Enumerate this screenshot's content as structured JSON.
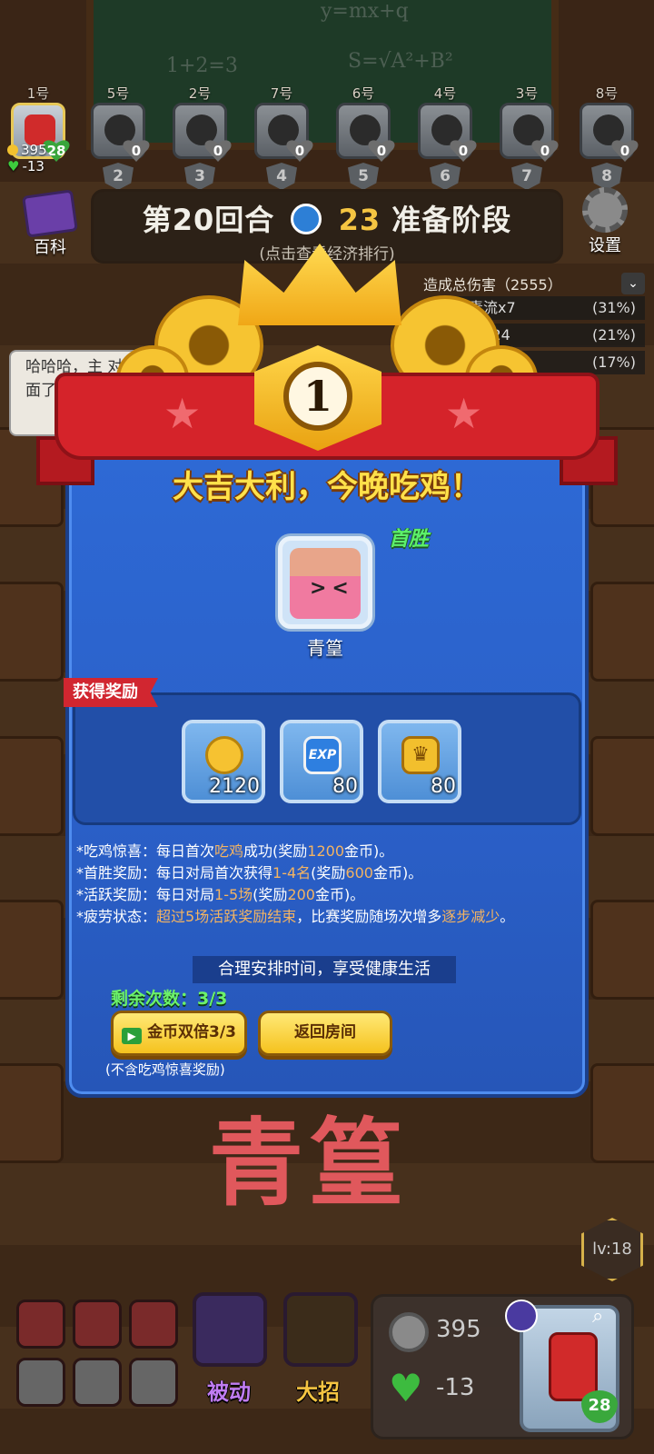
{
  "players": [
    {
      "no": "1号",
      "hp": "28",
      "rank": "",
      "me": true
    },
    {
      "no": "5号",
      "hp": "0",
      "rank": "2"
    },
    {
      "no": "2号",
      "hp": "0",
      "rank": "3"
    },
    {
      "no": "7号",
      "hp": "0",
      "rank": "4"
    },
    {
      "no": "6号",
      "hp": "0",
      "rank": "5"
    },
    {
      "no": "4号",
      "hp": "0",
      "rank": "6"
    },
    {
      "no": "3号",
      "hp": "0",
      "rank": "7"
    },
    {
      "no": "8号",
      "hp": "0",
      "rank": "8"
    }
  ],
  "wallet": {
    "coins": "395",
    "health": "-13"
  },
  "header": {
    "encyclopedia_label": "百科",
    "round_label": "第20回合",
    "timer": "23",
    "phase": "准备阶段",
    "subtitle": "(点击查看经济排行)",
    "settings_label": "设置"
  },
  "damage": {
    "title": "造成总伤害（2555）",
    "rows": [
      {
        "name": "中毒流x7",
        "pct": "(31%)"
      },
      {
        "name": "刺流x24",
        "pct": "(21%)"
      },
      {
        "name": "",
        "pct": "(17%)"
      }
    ]
  },
  "chat": {
    "text": "哈哈哈，主 对面了，你 ？"
  },
  "result": {
    "rank": "1",
    "title": "大吉大利，今晚吃鸡！",
    "first_win": "首胜",
    "hero_name": "青篁",
    "reward_tag": "获得奖励",
    "rewards": [
      {
        "icon": "coin-icon",
        "value": "2120"
      },
      {
        "icon": "exp-icon",
        "label": "EXP",
        "value": "80"
      },
      {
        "icon": "crown-token-icon",
        "value": "80"
      }
    ],
    "rules": [
      {
        "a": "*吃鸡惊喜：每日首次",
        "b": "吃鸡",
        "c": "成功(奖励",
        "d": "1200",
        "e": "金币)。"
      },
      {
        "a": "*首胜奖励：每日对局首次获得",
        "b": "1-4名",
        "c": "(奖励",
        "d": "600",
        "e": "金币)。"
      },
      {
        "a": "*活跃奖励：每日对局",
        "b": "1-5场",
        "c": "(奖励",
        "d": "200",
        "e": "金币)。"
      },
      {
        "a": "*疲劳状态：",
        "b": "超过5场活跃奖励结束",
        "c": "，比赛奖励随场次增多",
        "d": "逐步减少",
        "e": "。"
      }
    ],
    "tip": "合理安排时间，享受健康生活",
    "remaining": "剩余次数：3/3",
    "double_button": "金币双倍3/3",
    "return_button": "返回房间",
    "button_note": "(不含吃鸡惊喜奖励)"
  },
  "overlay_name": "青篁",
  "bottom": {
    "level": "lv:18",
    "passive_label": "被动",
    "ultimate_label": "大招",
    "coins": "395",
    "health": "-13",
    "my_hp": "28"
  },
  "colors": {
    "dialog_blue": "#2e6ad6",
    "ribbon_red": "#d5232a",
    "gold": "#ffe14a",
    "green": "#6cf26a",
    "highlight": "#f4b462",
    "overlay_text": "#e0585c",
    "passive_purple": "#c07cf2",
    "ultimate_gold": "#f5c542"
  }
}
